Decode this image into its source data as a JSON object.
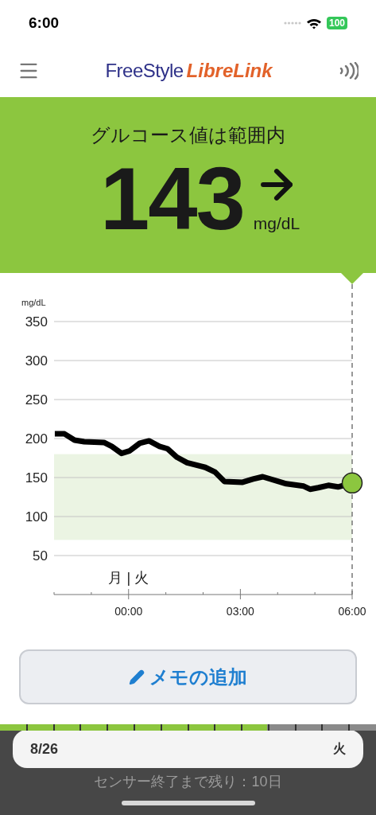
{
  "status_bar": {
    "time": "6:00",
    "battery": "100"
  },
  "header": {
    "logo_primary": "FreeStyle",
    "logo_secondary": "LibreLink"
  },
  "banner": {
    "title": "グルコース値は範囲内",
    "value": "143",
    "unit": "mg/dL"
  },
  "chart_data": {
    "type": "line",
    "ylabel": "mg/dL",
    "x": [
      -1.98,
      -1.72,
      -1.45,
      -1.19,
      -0.66,
      -0.45,
      -0.19,
      0.02,
      0.3,
      0.55,
      0.83,
      1.04,
      1.3,
      1.57,
      2.06,
      2.32,
      2.57,
      3.06,
      3.34,
      3.6,
      4.02,
      4.23,
      4.7,
      4.87,
      5.09,
      5.36,
      5.62,
      6
    ],
    "series": [
      {
        "color": "#000000",
        "values": [
          206,
          206,
          198,
          196,
          195,
          190,
          181,
          184,
          194,
          197,
          190,
          187,
          176,
          169,
          163,
          157,
          145,
          144,
          148,
          151,
          145,
          142,
          139,
          135,
          137,
          140,
          138,
          143
        ]
      }
    ],
    "xlim": [
      -2,
      6
    ],
    "ylim": [
      50,
      350
    ],
    "yticks": [
      50,
      100,
      150,
      200,
      250,
      300,
      350
    ],
    "xticks": [
      {
        "value": 0,
        "label": "00:00"
      },
      {
        "value": 3,
        "label": "03:00"
      },
      {
        "value": 6,
        "label": "06:00"
      }
    ],
    "grid": true,
    "bands": [
      {
        "axis": "y",
        "from": 70,
        "to": 180,
        "color": "#ebf4e3"
      }
    ]
  },
  "day_divider": {
    "label": "月 | 火"
  },
  "memo_button": {
    "label": "メモの追加"
  },
  "sensor": {
    "level": 0.71,
    "date": "8/26",
    "weekday": "火",
    "remaining": "センサー終了まで残り：10日"
  }
}
